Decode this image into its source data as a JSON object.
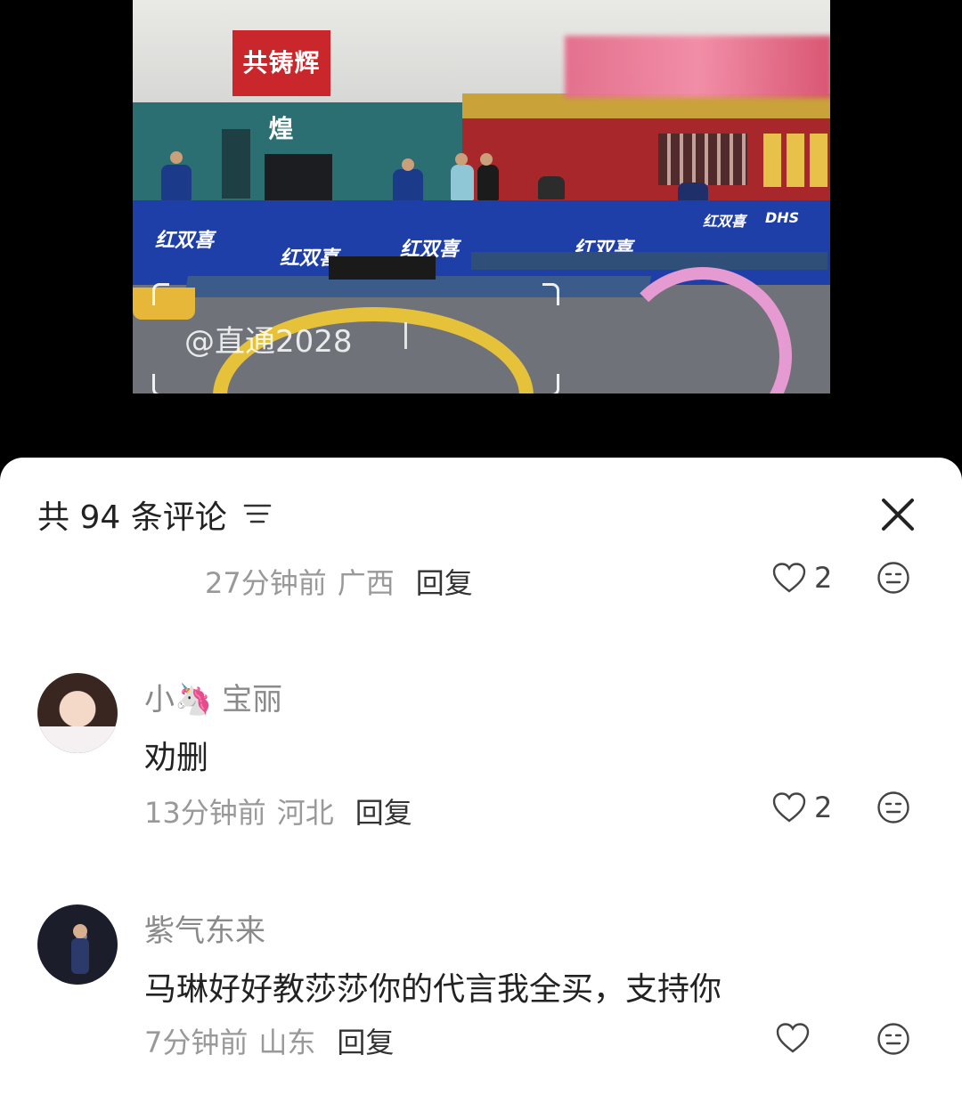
{
  "video": {
    "banner_text": "共铸辉煌",
    "watermark": "@直通2028",
    "ad_brand": "红双喜",
    "ad_brand_2": "DHS"
  },
  "sheet": {
    "title": "共 94 条评论",
    "sort_icon": "sort-lines-icon",
    "close_icon": "close-x-icon"
  },
  "comments": [
    {
      "time": "27分钟前",
      "place": "广西",
      "reply_label": "回复",
      "likes": "2"
    },
    {
      "username": "小🦄 宝丽",
      "text": "劝删",
      "time": "13分钟前",
      "place": "河北",
      "reply_label": "回复",
      "likes": "2"
    },
    {
      "username": "紫气东来",
      "text": "马琳好好教莎莎你的代言我全买，支持你",
      "time": "7分钟前",
      "place": "山东",
      "reply_label": "回复",
      "likes": ""
    }
  ]
}
